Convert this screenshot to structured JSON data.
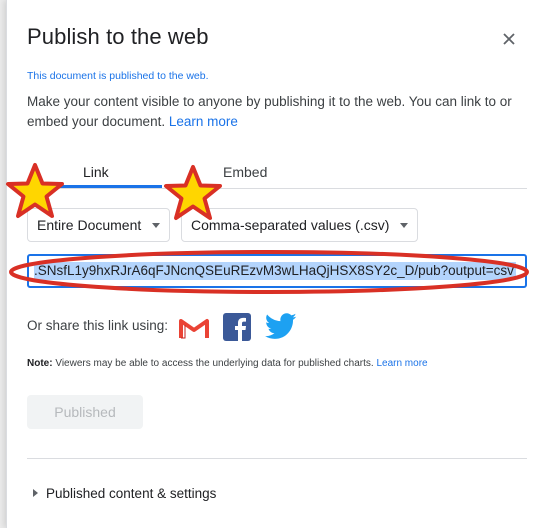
{
  "dialog": {
    "title": "Publish to the web",
    "status": "This document is published to the web.",
    "description": "Make your content visible to anyone by publishing it to the web. You can link to or embed your document.",
    "learn_more": "Learn more"
  },
  "tabs": [
    {
      "label": "Link",
      "selected": true
    },
    {
      "label": "Embed",
      "selected": false
    }
  ],
  "selects": {
    "scope": "Entire Document",
    "format": "Comma-separated values (.csv)"
  },
  "url": {
    "value": ".SNsfL1y9hxRJrA6qFJNcnQSEuREzvM3wLHaQjHSX8SY2c_D/pub?output=csv"
  },
  "share": {
    "label": "Or share this link using:",
    "icons": [
      "gmail-icon",
      "facebook-icon",
      "twitter-icon"
    ]
  },
  "note": {
    "prefix": "Note:",
    "text": " Viewers may be able to access the underlying data for published charts.",
    "learn_more": "Learn more"
  },
  "publish_button": "Published",
  "expander": "Published content & settings",
  "colors": {
    "accent": "#1a73e8",
    "annotation_red": "#d93025",
    "annotation_star": "#ffd600"
  }
}
